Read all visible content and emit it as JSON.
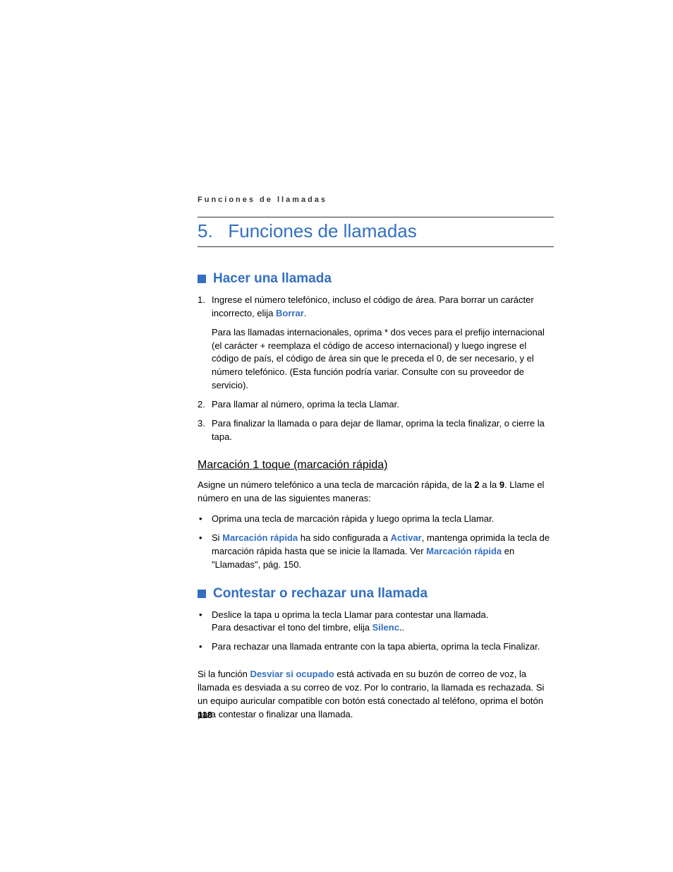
{
  "running_header": "Funciones de llamadas",
  "chapter": {
    "number": "5.",
    "title": "Funciones de llamadas"
  },
  "section1": {
    "title": "Hacer una llamada",
    "items": [
      {
        "num": "1.",
        "pre": "Ingrese el número telefónico, incluso el código de área. Para borrar un carácter incorrecto, elija ",
        "link": "Borrar",
        "post": ".",
        "sub": "Para las llamadas internacionales, oprima * dos veces para el prefijo internacional (el carácter + reemplaza el código de acceso internacional) y luego ingrese el código de país, el código de área sin que le preceda el 0, de ser necesario, y el número telefónico. (Esta función podría variar. Consulte con su proveedor de servicio)."
      },
      {
        "num": "2.",
        "text": "Para llamar al número, oprima la tecla Llamar."
      },
      {
        "num": "3.",
        "text": "Para finalizar la llamada o para dejar de llamar, oprima la tecla finalizar, o cierre la tapa."
      }
    ]
  },
  "subsection": {
    "title": "Marcación 1 toque (marcación rápida)",
    "intro_pre": "Asigne un número telefónico a una tecla de marcación rápida, de la ",
    "intro_bold1": "2",
    "intro_mid": " a la ",
    "intro_bold2": "9",
    "intro_post": ". Llame el número en una de las siguientes maneras:",
    "bullets": [
      {
        "text": "Oprima una tecla de marcación rápida y luego oprima la tecla Llamar."
      },
      {
        "pre": "Si ",
        "link1": "Marcación rápida",
        "mid1": " ha sido configurada a ",
        "link2": "Activar",
        "mid2": ", mantenga oprimida la tecla de marcación rápida hasta que se inicie la llamada. Ver ",
        "link3": "Marcación rápida",
        "post": " en \"Llamadas\", pág. 150."
      }
    ]
  },
  "section2": {
    "title": "Contestar o rechazar una llamada",
    "bullets": [
      {
        "line1": "Deslice la tapa u oprima la tecla Llamar para contestar una llamada.",
        "line2_pre": "Para desactivar el tono del timbre, elija ",
        "line2_link": "Silenc.",
        "line2_post": "."
      },
      {
        "text": "Para rechazar una llamada entrante con la tapa abierta, oprima la tecla Finalizar."
      }
    ],
    "para_pre": "Si la función ",
    "para_link": "Desviar si ocupado",
    "para_post": " está activada en su buzón de correo de voz, la llamada es desviada a su correo de voz. Por lo contrario, la llamada es rechazada. Si un equipo auricular compatible con botón está conectado al teléfono, oprima el botón para contestar o finalizar una llamada."
  },
  "page_number": "118"
}
